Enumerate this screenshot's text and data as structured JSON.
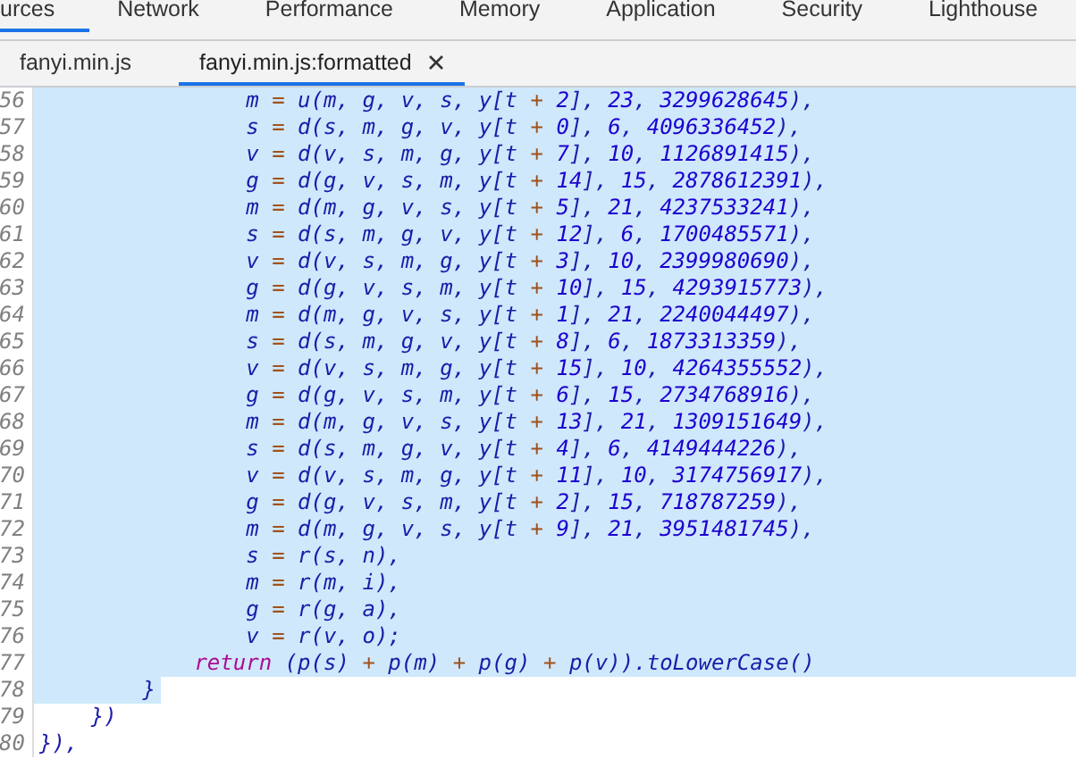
{
  "panel_tabs": [
    {
      "label": "urces",
      "selected": true
    },
    {
      "label": "Network",
      "selected": false
    },
    {
      "label": "Performance",
      "selected": false
    },
    {
      "label": "Memory",
      "selected": false
    },
    {
      "label": "Application",
      "selected": false
    },
    {
      "label": "Security",
      "selected": false
    },
    {
      "label": "Lighthouse",
      "selected": false
    }
  ],
  "file_tabs": [
    {
      "label": "fanyi.min.js",
      "selected": false,
      "closable": false
    },
    {
      "label": "fanyi.min.js:formatted",
      "selected": true,
      "closable": true
    }
  ],
  "editor": {
    "lines": [
      {
        "number": "56",
        "selected": true,
        "segments": [
          {
            "kind": "code",
            "text": "                m = u(m, g, v, s, y[t + 2], 23, 3299628645),"
          }
        ]
      },
      {
        "number": "57",
        "selected": true,
        "segments": [
          {
            "kind": "code",
            "text": "                s = d(s, m, g, v, y[t + 0], 6, 4096336452),"
          }
        ]
      },
      {
        "number": "58",
        "selected": true,
        "segments": [
          {
            "kind": "code",
            "text": "                v = d(v, s, m, g, y[t + 7], 10, 1126891415),"
          }
        ]
      },
      {
        "number": "59",
        "selected": true,
        "segments": [
          {
            "kind": "code",
            "text": "                g = d(g, v, s, m, y[t + 14], 15, 2878612391),"
          }
        ]
      },
      {
        "number": "60",
        "selected": true,
        "segments": [
          {
            "kind": "code",
            "text": "                m = d(m, g, v, s, y[t + 5], 21, 4237533241),"
          }
        ]
      },
      {
        "number": "61",
        "selected": true,
        "segments": [
          {
            "kind": "code",
            "text": "                s = d(s, m, g, v, y[t + 12], 6, 1700485571),"
          }
        ]
      },
      {
        "number": "62",
        "selected": true,
        "segments": [
          {
            "kind": "code",
            "text": "                v = d(v, s, m, g, y[t + 3], 10, 2399980690),"
          }
        ]
      },
      {
        "number": "63",
        "selected": true,
        "segments": [
          {
            "kind": "code",
            "text": "                g = d(g, v, s, m, y[t + 10], 15, 4293915773),"
          }
        ]
      },
      {
        "number": "64",
        "selected": true,
        "segments": [
          {
            "kind": "code",
            "text": "                m = d(m, g, v, s, y[t + 1], 21, 2240044497),"
          }
        ]
      },
      {
        "number": "65",
        "selected": true,
        "segments": [
          {
            "kind": "code",
            "text": "                s = d(s, m, g, v, y[t + 8], 6, 1873313359),"
          }
        ]
      },
      {
        "number": "66",
        "selected": true,
        "segments": [
          {
            "kind": "code",
            "text": "                v = d(v, s, m, g, y[t + 15], 10, 4264355552),"
          }
        ]
      },
      {
        "number": "67",
        "selected": true,
        "segments": [
          {
            "kind": "code",
            "text": "                g = d(g, v, s, m, y[t + 6], 15, 2734768916),"
          }
        ]
      },
      {
        "number": "68",
        "selected": true,
        "segments": [
          {
            "kind": "code",
            "text": "                m = d(m, g, v, s, y[t + 13], 21, 1309151649),"
          }
        ]
      },
      {
        "number": "69",
        "selected": true,
        "segments": [
          {
            "kind": "code",
            "text": "                s = d(s, m, g, v, y[t + 4], 6, 4149444226),"
          }
        ]
      },
      {
        "number": "70",
        "selected": true,
        "segments": [
          {
            "kind": "code",
            "text": "                v = d(v, s, m, g, y[t + 11], 10, 3174756917),"
          }
        ]
      },
      {
        "number": "71",
        "selected": true,
        "segments": [
          {
            "kind": "code",
            "text": "                g = d(g, v, s, m, y[t + 2], 15, 718787259),"
          }
        ]
      },
      {
        "number": "72",
        "selected": true,
        "segments": [
          {
            "kind": "code",
            "text": "                m = d(m, g, v, s, y[t + 9], 21, 3951481745),"
          }
        ]
      },
      {
        "number": "73",
        "selected": true,
        "segments": [
          {
            "kind": "code",
            "text": "                s = r(s, n),"
          }
        ]
      },
      {
        "number": "74",
        "selected": true,
        "segments": [
          {
            "kind": "code",
            "text": "                m = r(m, i),"
          }
        ]
      },
      {
        "number": "75",
        "selected": true,
        "segments": [
          {
            "kind": "code",
            "text": "                g = r(g, a),"
          }
        ]
      },
      {
        "number": "76",
        "selected": true,
        "segments": [
          {
            "kind": "code",
            "text": "                v = r(v, o);"
          }
        ]
      },
      {
        "number": "77",
        "selected": true,
        "segments": [
          {
            "kind": "keyword",
            "text": "            return"
          },
          {
            "kind": "code",
            "text": " (p(s) + p(m) + p(g) + p(v)).toLowerCase()"
          }
        ]
      },
      {
        "number": "78",
        "selected": true,
        "segments": [
          {
            "kind": "code",
            "text": "        }"
          }
        ]
      },
      {
        "number": "79",
        "selected": false,
        "segments": [
          {
            "kind": "code",
            "text": "    })"
          }
        ]
      },
      {
        "number": "80",
        "selected": false,
        "segments": [
          {
            "kind": "code",
            "text": "}),"
          }
        ]
      }
    ]
  }
}
